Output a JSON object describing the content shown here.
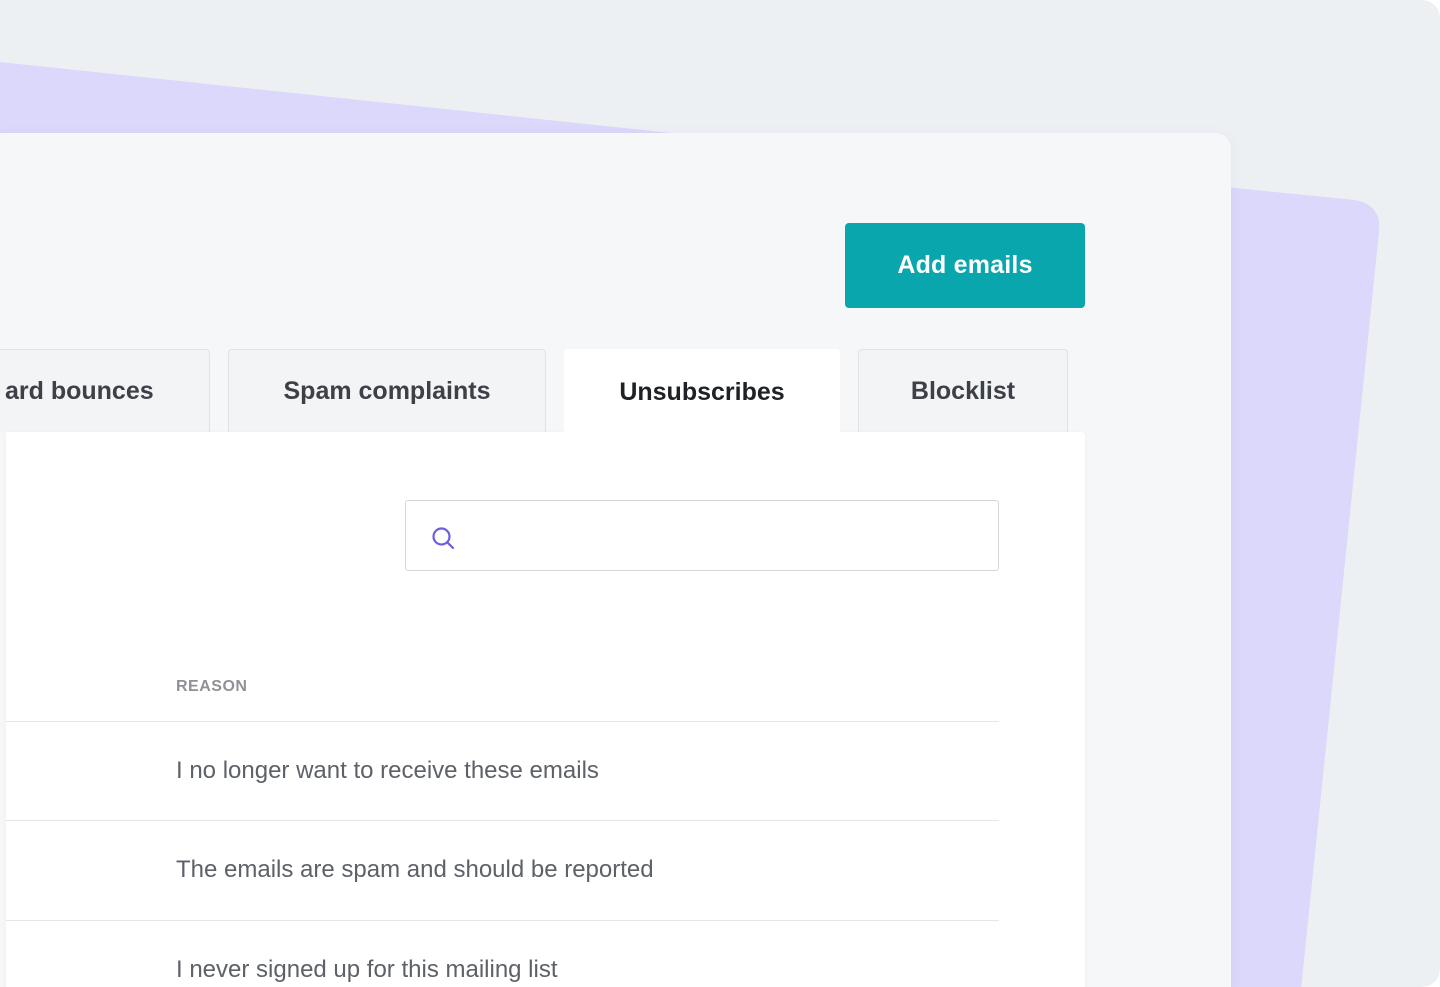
{
  "header": {
    "add_button_label": "Add emails"
  },
  "tabs": [
    {
      "label": "ard bounces",
      "active": false
    },
    {
      "label": "Spam complaints",
      "active": false
    },
    {
      "label": "Unsubscribes",
      "active": true
    },
    {
      "label": "Blocklist",
      "active": false
    }
  ],
  "search": {
    "icon": "search-icon",
    "value": ""
  },
  "table": {
    "column_header": "REASON",
    "rows": [
      {
        "reason": "I no longer want to receive these emails"
      },
      {
        "reason": "The emails are spam and should be reported"
      },
      {
        "reason": "I never signed up for this mailing list"
      }
    ]
  },
  "colors": {
    "accent": "#0aa6ad",
    "decoration": "#dcd8fb",
    "search_icon": "#6b5fe0"
  }
}
